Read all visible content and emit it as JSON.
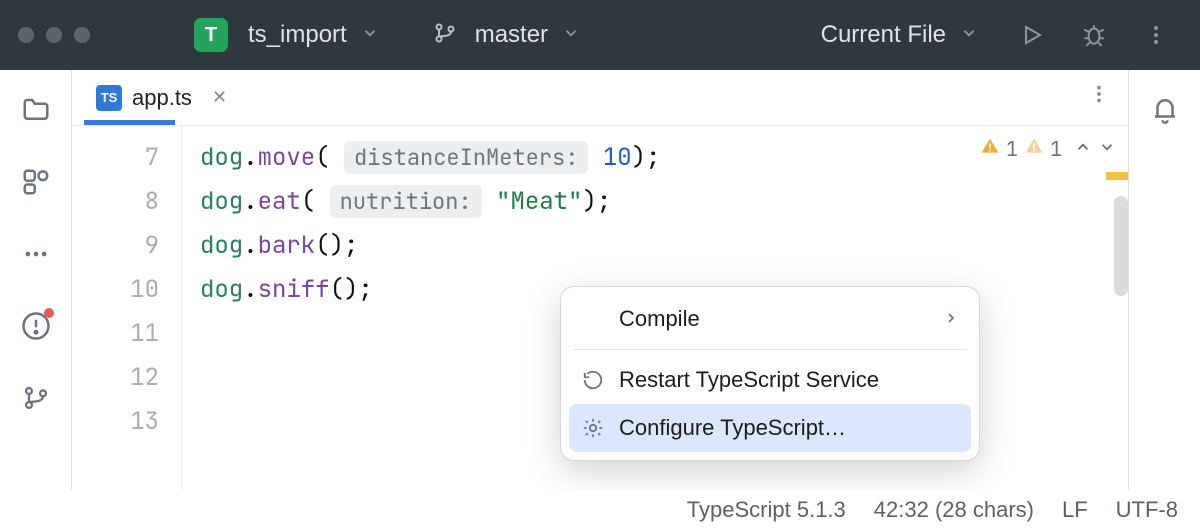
{
  "titlebar": {
    "project_badge": "T",
    "project_name": "ts_import",
    "branch_name": "master",
    "run_config": "Current File"
  },
  "tabs": {
    "active": {
      "label": "app.ts",
      "icon_label": "TS"
    }
  },
  "code": {
    "lines": [
      {
        "ln": "7"
      },
      {
        "ln": "8"
      },
      {
        "ln": "9"
      },
      {
        "ln": "10"
      },
      {
        "ln": "11"
      },
      {
        "ln": "12"
      },
      {
        "ln": "13"
      }
    ],
    "line7": {
      "obj": "dog",
      "method": "move",
      "hint": "distanceInMeters:",
      "number": "10",
      "tail": ");"
    },
    "line8": {
      "obj": "dog",
      "method": "eat",
      "hint": "nutrition:",
      "string": "\"Meat\"",
      "tail": ");"
    },
    "line9": {
      "obj": "dog",
      "method": "bark",
      "tail": "();"
    },
    "line10": {
      "obj": "dog",
      "method": "sniff",
      "tail": "();"
    }
  },
  "inspections": {
    "warn1": "1",
    "warn2": "1"
  },
  "popup": {
    "compile": "Compile",
    "restart": "Restart TypeScript Service",
    "configure": "Configure TypeScript…"
  },
  "statusbar": {
    "ts_version": "TypeScript 5.1.3",
    "caret": "42:32 (28 chars)",
    "line_sep": "LF",
    "encoding": "UTF-8"
  }
}
